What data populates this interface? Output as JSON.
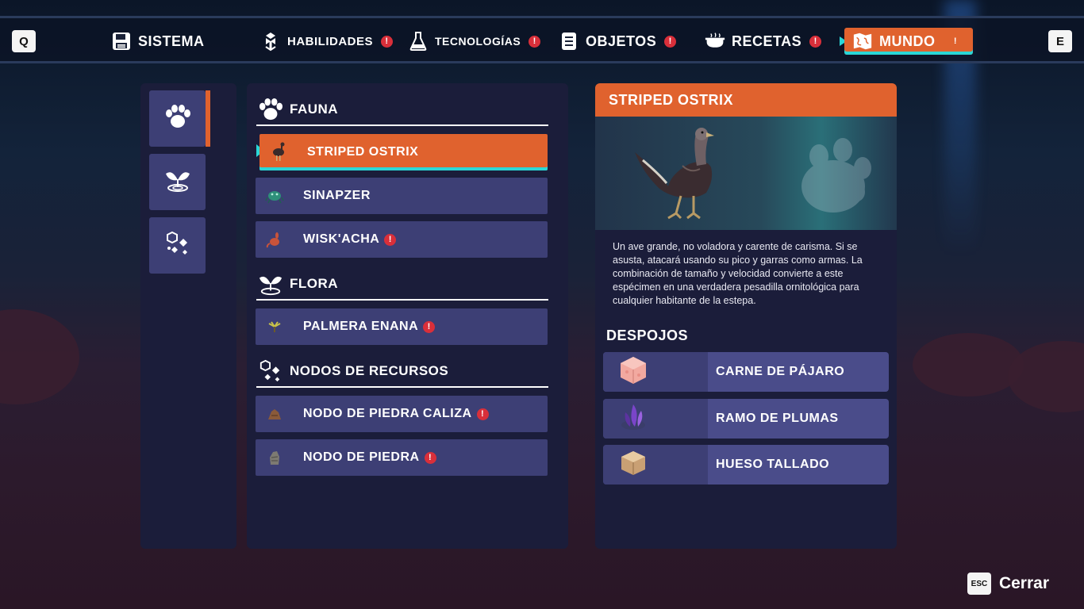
{
  "topbar": {
    "prev_key": "Q",
    "next_key": "E",
    "tabs": [
      {
        "label": "SISTEMA",
        "icon": "save-icon",
        "alert": ""
      },
      {
        "label": "HABILIDADES",
        "icon": "skill-tree-icon",
        "alert": "!"
      },
      {
        "label": "TECNOLOGÍAS",
        "icon": "flask-icon",
        "alert": "!"
      },
      {
        "label": "OBJETOS",
        "icon": "list-icon",
        "alert": "!"
      },
      {
        "label": "RECETAS",
        "icon": "cooking-pot-icon",
        "alert": "!"
      },
      {
        "label": "MUNDO",
        "icon": "map-icon",
        "alert": "!"
      }
    ]
  },
  "categories": [
    {
      "icon": "paw-icon",
      "active": true
    },
    {
      "icon": "sprout-icon",
      "active": false
    },
    {
      "icon": "crystal-nodes-icon",
      "active": false
    }
  ],
  "list": {
    "sections": [
      {
        "title": "FAUNA",
        "icon": "paw-icon"
      },
      {
        "title": "FLORA",
        "icon": "sprout-icon"
      },
      {
        "title": "NODOS DE RECURSOS",
        "icon": "crystal-nodes-icon"
      }
    ],
    "items": [
      {
        "label": "STRIPED OSTRIX",
        "alert": "",
        "icon": "ostrich-icon"
      },
      {
        "label": "SINAPZER",
        "alert": "",
        "icon": "crab-icon"
      },
      {
        "label": "WISK'ACHA",
        "alert": "!",
        "icon": "rodent-icon"
      },
      {
        "label": "PALMERA ENANA",
        "alert": "!",
        "icon": "palm-icon"
      },
      {
        "label": "NODO DE PIEDRA CALIZA",
        "alert": "!",
        "icon": "limestone-icon"
      },
      {
        "label": "NODO DE PIEDRA",
        "alert": "!",
        "icon": "stone-icon"
      }
    ]
  },
  "detail": {
    "title": "STRIPED OSTRIX",
    "description": "Un ave grande, no voladora y carente de carisma. Si se asusta, atacará usando su pico y garras como armas. La combinación de tamaño y velocidad convierte a este espécimen en una verdadera pesadilla ornitológica para cualquier habitante de la estepa.",
    "loot_title": "DESPOJOS",
    "loot": [
      {
        "label": "CARNE DE PÁJARO",
        "icon": "meat-cube-icon",
        "color": "#f2a9a0"
      },
      {
        "label": "RAMO DE PLUMAS",
        "icon": "feathers-icon",
        "color": "#7a45c9"
      },
      {
        "label": "HUESO TALLADO",
        "icon": "bone-cube-icon",
        "color": "#d8b488"
      }
    ]
  },
  "footer": {
    "key": "ESC",
    "label": "Cerrar"
  },
  "colors": {
    "accent": "#e0622e",
    "highlight": "#2ad7d7",
    "panel": "#1b1d3a",
    "row": "#3d3f75",
    "alert": "#d92f3a"
  }
}
